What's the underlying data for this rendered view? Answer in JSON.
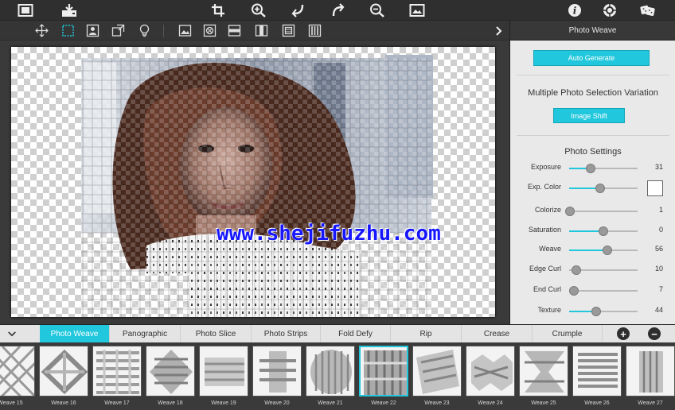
{
  "toolbar": {
    "top_icons": [
      "image-icon",
      "save-icon",
      "crop-icon",
      "zoom-in-icon",
      "undo-icon",
      "redo-icon",
      "zoom-out-icon",
      "fit-image-icon",
      "info-icon",
      "settings-gear-icon",
      "dice-icon"
    ],
    "secondary_icons": [
      "move-icon",
      "select-icon",
      "portrait-icon",
      "transform-icon",
      "lightbulb-icon",
      "image-landscape-icon",
      "mask-icon",
      "horizontal-strips-icon",
      "vertical-split-icon",
      "frame-icon",
      "vertical-stripes-icon"
    ]
  },
  "canvas": {
    "watermark": "www.shejifuzhu.com"
  },
  "panel": {
    "header": "Photo Weave",
    "auto_generate_label": "Auto Generate",
    "variation_title": "Multiple Photo Selection Variation",
    "image_shift_label": "Image Shift",
    "settings_title": "Photo Settings",
    "sliders": [
      {
        "label": "Exposure",
        "value": "31",
        "fraction": 0.31,
        "fill": true
      },
      {
        "label": "Exp. Color",
        "value": "",
        "fraction": 0.45,
        "fill": true,
        "swatch": "#ffffff"
      },
      {
        "label": "Colorize",
        "value": "1",
        "fraction": 0.01,
        "fill": false
      },
      {
        "label": "Saturation",
        "value": "0",
        "fraction": 0.5,
        "fill": true
      },
      {
        "label": "Weave",
        "value": "56",
        "fraction": 0.56,
        "fill": true
      },
      {
        "label": "Edge Curl",
        "value": "10",
        "fraction": 0.1,
        "fill": false
      },
      {
        "label": "End Curl",
        "value": "7",
        "fraction": 0.07,
        "fill": false
      },
      {
        "label": "Texture",
        "value": "44",
        "fraction": 0.4,
        "fill": true
      }
    ]
  },
  "tabs": {
    "items": [
      "Photo Weave",
      "Panographic",
      "Photo Slice",
      "Photo Strips",
      "Fold Defy",
      "Rip",
      "Crease",
      "Crumple"
    ],
    "active": "Photo Weave",
    "plus_label": "+",
    "minus_label": "−"
  },
  "thumbnails": {
    "items": [
      "Weave 15",
      "Weave 16",
      "Weave 17",
      "Weave 18",
      "Weave 19",
      "Weave 20",
      "Weave 21",
      "Weave 22",
      "Weave 23",
      "Weave 24",
      "Weave 25",
      "Weave 26",
      "Weave 27"
    ],
    "selected": "Weave 22"
  },
  "colors": {
    "accent": "#21c7dc",
    "toolbar_bg": "#2f2f2f",
    "panel_bg": "#e9e9e9"
  }
}
